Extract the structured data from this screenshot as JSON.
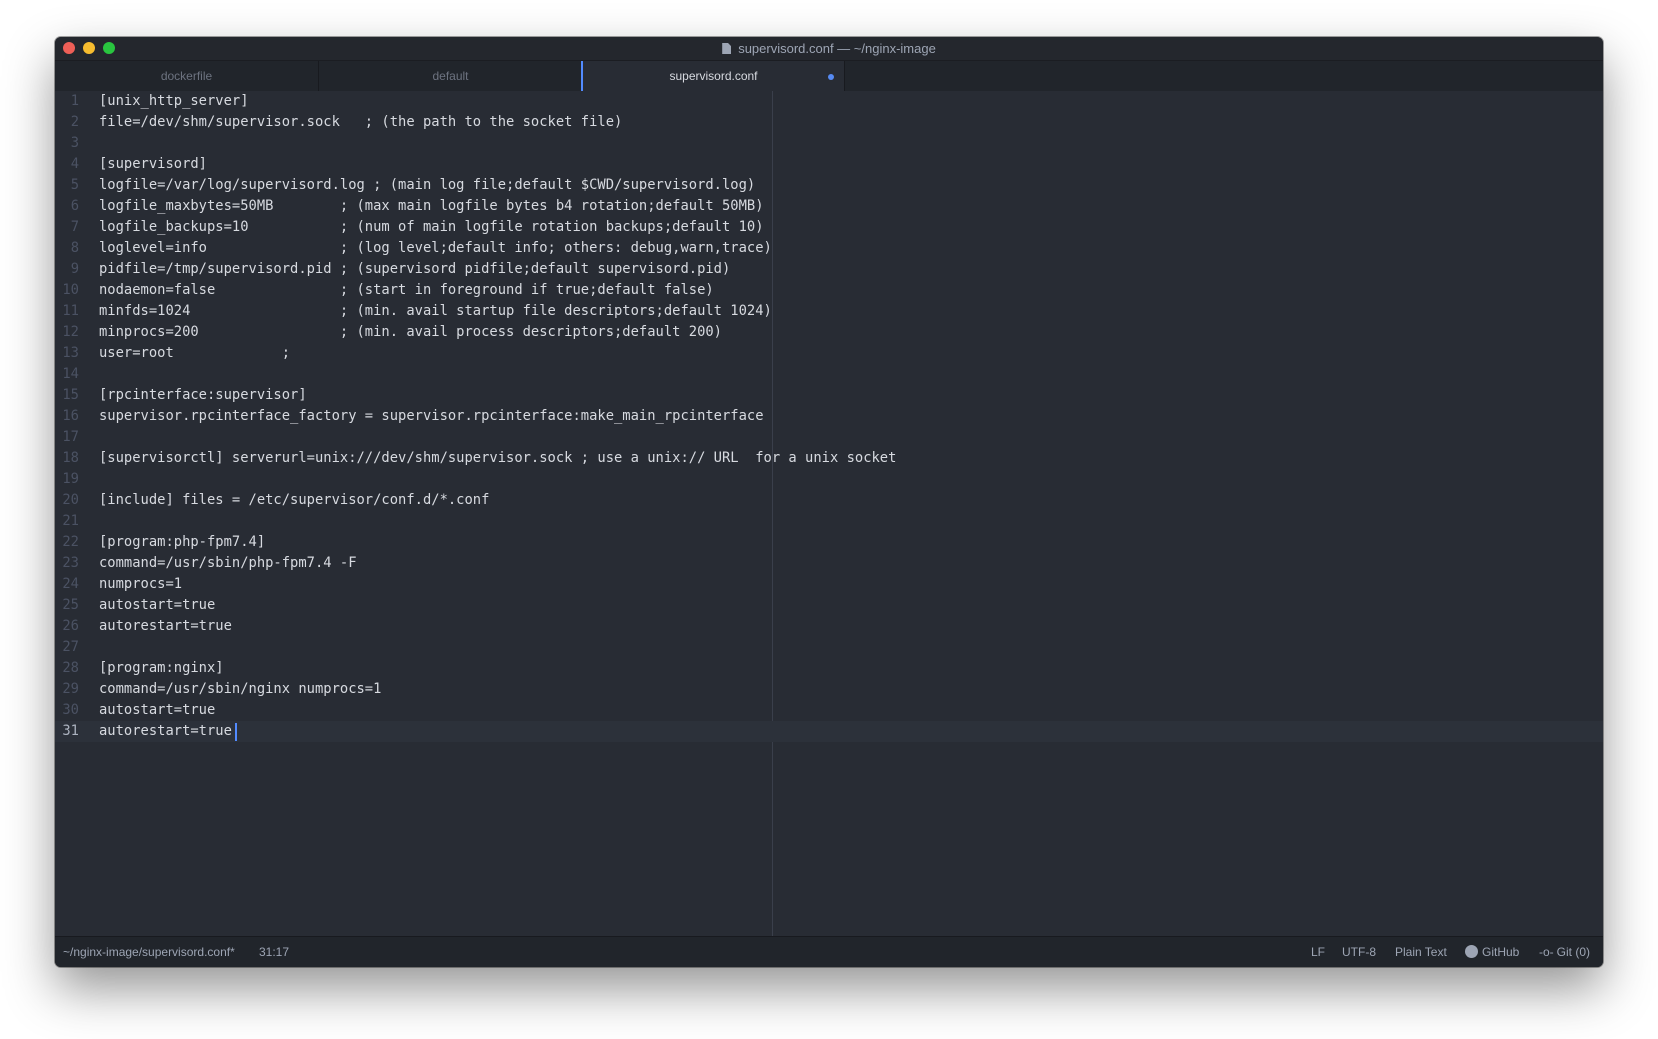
{
  "window": {
    "title": "supervisord.conf — ~/nginx-image"
  },
  "tabs": [
    {
      "label": "dockerfile",
      "active": false
    },
    {
      "label": "default",
      "active": false
    },
    {
      "label": "supervisord.conf",
      "active": true,
      "modified": true
    }
  ],
  "editor": {
    "lines": [
      "[unix_http_server]",
      "file=/dev/shm/supervisor.sock   ; (the path to the socket file)",
      "",
      "[supervisord]",
      "logfile=/var/log/supervisord.log ; (main log file;default $CWD/supervisord.log)",
      "logfile_maxbytes=50MB        ; (max main logfile bytes b4 rotation;default 50MB)",
      "logfile_backups=10           ; (num of main logfile rotation backups;default 10)",
      "loglevel=info                ; (log level;default info; others: debug,warn,trace)",
      "pidfile=/tmp/supervisord.pid ; (supervisord pidfile;default supervisord.pid)",
      "nodaemon=false               ; (start in foreground if true;default false)",
      "minfds=1024                  ; (min. avail startup file descriptors;default 1024)",
      "minprocs=200                 ; (min. avail process descriptors;default 200)",
      "user=root             ;",
      "",
      "[rpcinterface:supervisor]",
      "supervisor.rpcinterface_factory = supervisor.rpcinterface:make_main_rpcinterface",
      "",
      "[supervisorctl] serverurl=unix:///dev/shm/supervisor.sock ; use a unix:// URL  for a unix socket",
      "",
      "[include] files = /etc/supervisor/conf.d/*.conf",
      "",
      "[program:php-fpm7.4]",
      "command=/usr/sbin/php-fpm7.4 -F",
      "numprocs=1",
      "autostart=true",
      "autorestart=true",
      "",
      "[program:nginx]",
      "command=/usr/sbin/nginx numprocs=1",
      "autostart=true",
      "autorestart=true"
    ],
    "cursor_line": 31
  },
  "status": {
    "path": "~/nginx-image/supervisord.conf*",
    "cursor_position": "31:17",
    "line_ending": "LF",
    "encoding": "UTF-8",
    "grammar": "Plain Text",
    "github": "GitHub",
    "git": "Git (0)"
  },
  "colors": {
    "editor_bg": "#282c34",
    "tabbar_bg": "#21252b",
    "accent": "#528bff",
    "text": "#d7dae0"
  }
}
